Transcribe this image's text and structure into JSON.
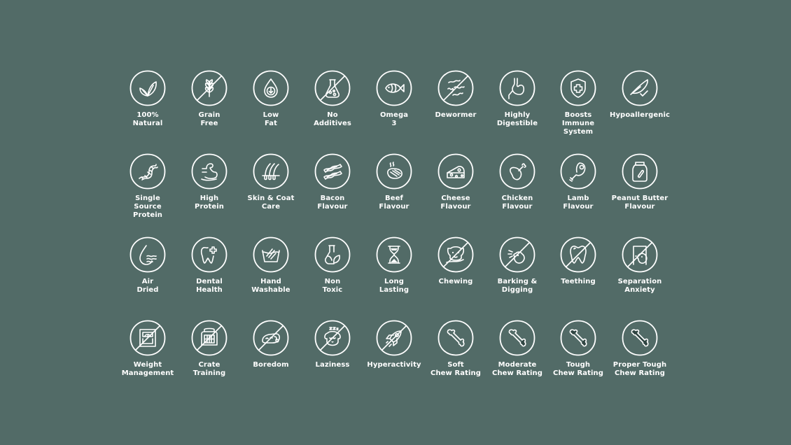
{
  "colors": {
    "background": "#526b67",
    "foreground": "#ffffff"
  },
  "rows": [
    [
      {
        "icon": "leaf-icon",
        "lines": [
          "100%",
          "Natural"
        ],
        "crossed": false
      },
      {
        "icon": "wheat-icon",
        "lines": [
          "Grain",
          "Free"
        ],
        "crossed": true
      },
      {
        "icon": "drop-arrow-icon",
        "lines": [
          "Low",
          "Fat"
        ],
        "crossed": false
      },
      {
        "icon": "flask-icon",
        "lines": [
          "No",
          "Additives"
        ],
        "crossed": true
      },
      {
        "icon": "fish-icon",
        "lines": [
          "Omega",
          "3"
        ],
        "crossed": false
      },
      {
        "icon": "worms-icon",
        "lines": [
          "Dewormer"
        ],
        "crossed": true
      },
      {
        "icon": "stomach-icon",
        "lines": [
          "Highly",
          "Digestible"
        ],
        "crossed": false
      },
      {
        "icon": "shield-cross-icon",
        "lines": [
          "Boosts",
          "Immune",
          "System"
        ],
        "crossed": false
      },
      {
        "icon": "feather-check-icon",
        "lines": [
          "Hypoallergenic"
        ],
        "crossed": false
      }
    ],
    [
      {
        "icon": "dna-icon",
        "lines": [
          "Single",
          "Source",
          "Protein"
        ],
        "crossed": false
      },
      {
        "icon": "muscle-icon",
        "lines": [
          "High",
          "Protein"
        ],
        "crossed": false
      },
      {
        "icon": "hair-follicle-icon",
        "lines": [
          "Skin & Coat",
          "Care"
        ],
        "crossed": false
      },
      {
        "icon": "bacon-icon",
        "lines": [
          "Bacon",
          "Flavour"
        ],
        "crossed": false
      },
      {
        "icon": "steak-icon",
        "lines": [
          "Beef",
          "Flavour"
        ],
        "crossed": false
      },
      {
        "icon": "cheese-icon",
        "lines": [
          "Cheese",
          "Flavour"
        ],
        "crossed": false
      },
      {
        "icon": "chicken-leg-icon",
        "lines": [
          "Chicken",
          "Flavour"
        ],
        "crossed": false
      },
      {
        "icon": "lamb-leg-icon",
        "lines": [
          "Lamb",
          "Flavour"
        ],
        "crossed": false
      },
      {
        "icon": "jar-icon",
        "lines": [
          "Peanut Butter",
          "Flavour"
        ],
        "crossed": false
      }
    ],
    [
      {
        "icon": "drop-waves-icon",
        "lines": [
          "Air",
          "Dried"
        ],
        "crossed": false
      },
      {
        "icon": "tooth-plus-icon",
        "lines": [
          "Dental",
          "Health"
        ],
        "crossed": false
      },
      {
        "icon": "hand-wash-icon",
        "lines": [
          "Hand",
          "Washable"
        ],
        "crossed": false
      },
      {
        "icon": "flask-leaf-icon",
        "lines": [
          "Non",
          "Toxic"
        ],
        "crossed": false
      },
      {
        "icon": "hourglass-icon",
        "lines": [
          "Long",
          "Lasting"
        ],
        "crossed": false
      },
      {
        "icon": "dog-hand-icon",
        "lines": [
          "Chewing"
        ],
        "crossed": true
      },
      {
        "icon": "barking-dog-icon",
        "lines": [
          "Barking &",
          "Digging"
        ],
        "crossed": true
      },
      {
        "icon": "tooth-icon",
        "lines": [
          "Teething"
        ],
        "crossed": true
      },
      {
        "icon": "dog-door-icon",
        "lines": [
          "Separation",
          "Anxiety"
        ],
        "crossed": true
      }
    ],
    [
      {
        "icon": "scale-icon",
        "lines": [
          "Weight",
          "Management"
        ],
        "crossed": true
      },
      {
        "icon": "crate-icon",
        "lines": [
          "Crate",
          "Training"
        ],
        "crossed": true
      },
      {
        "icon": "sleeping-dog-icon",
        "lines": [
          "Boredom"
        ],
        "crossed": true
      },
      {
        "icon": "sleepy-dog-icon",
        "lines": [
          "Laziness"
        ],
        "crossed": true
      },
      {
        "icon": "rocket-icon",
        "lines": [
          "Hyperactivity"
        ],
        "crossed": true
      },
      {
        "icon": "bone-icon",
        "lines": [
          "Soft",
          "Chew Rating"
        ],
        "crossed": false,
        "chew_level": 0
      },
      {
        "icon": "bone-icon",
        "lines": [
          "Moderate",
          "Chew Rating"
        ],
        "crossed": false,
        "chew_level": 1
      },
      {
        "icon": "bone-icon",
        "lines": [
          "Tough",
          "Chew Rating"
        ],
        "crossed": false,
        "chew_level": 2
      },
      {
        "icon": "bone-icon",
        "lines": [
          "Proper Tough",
          "Chew Rating"
        ],
        "crossed": false,
        "chew_level": 3
      }
    ]
  ]
}
